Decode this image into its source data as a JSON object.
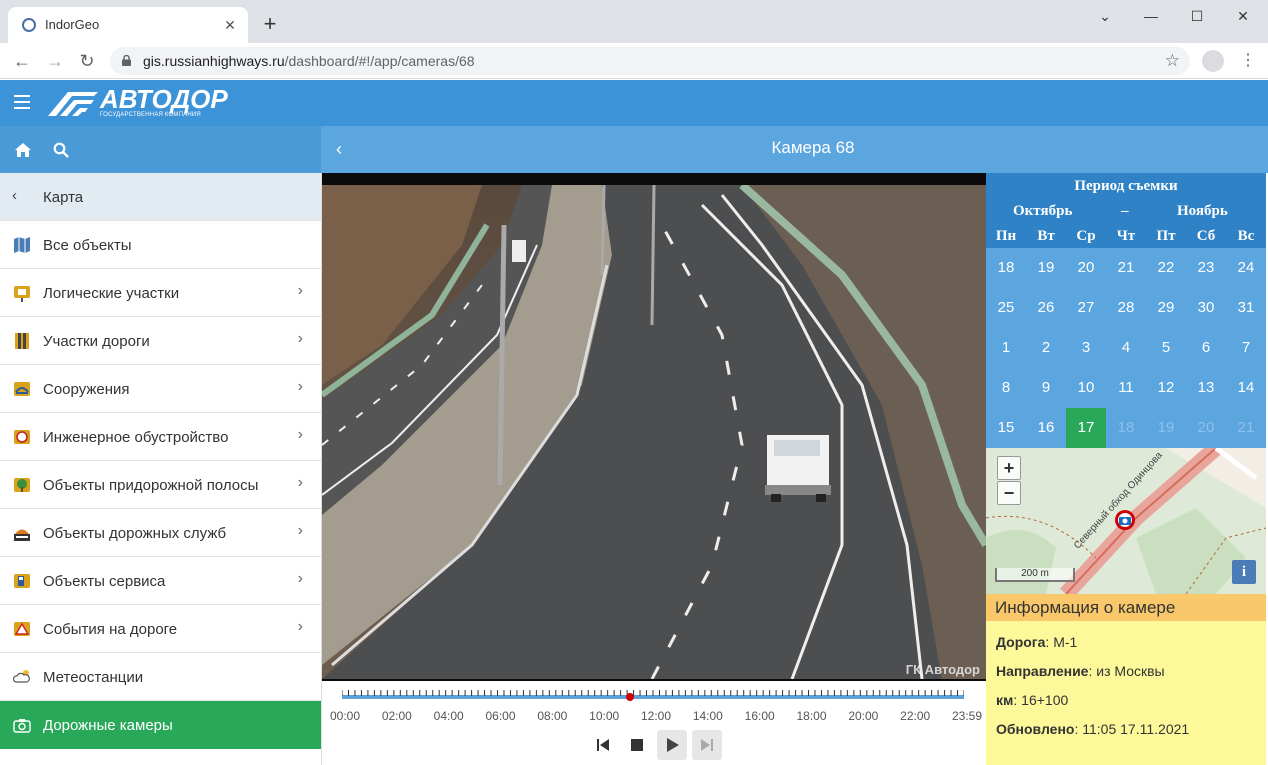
{
  "browser": {
    "tab_title": "IndorGeo",
    "url_host": "gis.russianhighways.ru",
    "url_path": "/dashboard/#!/app/cameras/68"
  },
  "header": {
    "logo_text": "АВТОДОР",
    "logo_sub": "ГОСУДАРСТВЕННАЯ КОМПАНИЯ"
  },
  "camera": {
    "title": "Камера 68",
    "watermark": "ГК Автодор"
  },
  "sidebar": {
    "map_label": "Карта",
    "items": [
      {
        "label": "Все объекты"
      },
      {
        "label": "Логические участки"
      },
      {
        "label": "Участки дороги"
      },
      {
        "label": "Сооружения"
      },
      {
        "label": "Инженерное обустройство"
      },
      {
        "label": "Объекты придорожной полосы"
      },
      {
        "label": "Объекты дорожных служб"
      },
      {
        "label": "Объекты сервиса"
      },
      {
        "label": "События на дороге"
      },
      {
        "label": "Метеостанции"
      },
      {
        "label": "Дорожные камеры"
      }
    ]
  },
  "timeline": {
    "labels": [
      "00:00",
      "02:00",
      "04:00",
      "06:00",
      "08:00",
      "10:00",
      "12:00",
      "14:00",
      "16:00",
      "18:00",
      "20:00",
      "22:00",
      "23:59"
    ],
    "position_fraction": 0.463
  },
  "calendar": {
    "title": "Период съемки",
    "month_from": "Октябрь",
    "dash": "–",
    "month_to": "Ноябрь",
    "weekdays": [
      "Пн",
      "Вт",
      "Ср",
      "Чт",
      "Пт",
      "Сб",
      "Вс"
    ],
    "weeks": [
      [
        "18",
        "19",
        "20",
        "21",
        "22",
        "23",
        "24"
      ],
      [
        "25",
        "26",
        "27",
        "28",
        "29",
        "30",
        "31"
      ],
      [
        "1",
        "2",
        "3",
        "4",
        "5",
        "6",
        "7"
      ],
      [
        "8",
        "9",
        "10",
        "11",
        "12",
        "13",
        "14"
      ],
      [
        "15",
        "16",
        "17",
        "18",
        "19",
        "20",
        "21"
      ]
    ],
    "today": "17"
  },
  "minimap": {
    "zoom_in": "+",
    "zoom_out": "−",
    "scale": "200 m",
    "info": "i",
    "street_label": "Северный обход Одинцова"
  },
  "info": {
    "title": "Информация о камере",
    "road_label": "Дорога",
    "road_value": ": М-1",
    "direction_label": "Направление",
    "direction_value": ": из Москвы",
    "km_label": "км",
    "km_value": ": 16+100",
    "updated_label": "Обновлено",
    "updated_value": ": 11:05 17.11.2021"
  },
  "colors": {
    "header": "#3d93d8",
    "active_item": "#2aa85a",
    "calendar": "#5ba6df",
    "info_head": "#f8c86a",
    "info_bg": "#fdf99a"
  }
}
